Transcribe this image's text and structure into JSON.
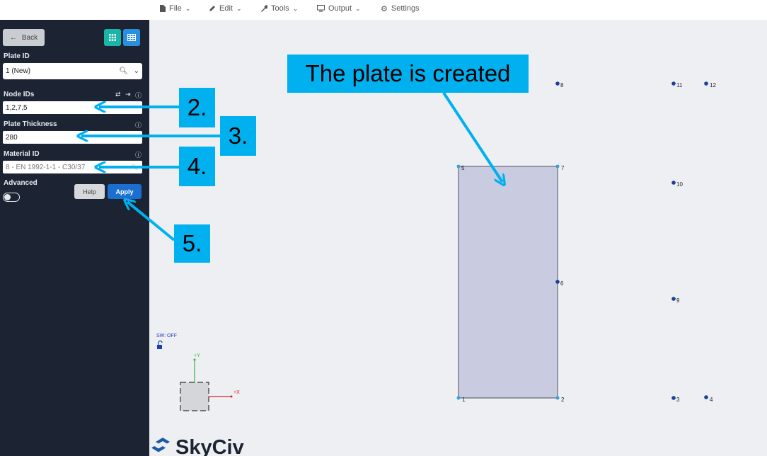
{
  "menu": {
    "file": "File",
    "edit": "Edit",
    "tools": "Tools",
    "output": "Output",
    "settings": "Settings"
  },
  "sidebar": {
    "back_label": "Back",
    "plate_id_label": "Plate ID",
    "plate_id_value": "1 (New)",
    "node_ids_label": "Node IDs",
    "node_ids_value": "1,2,7,5",
    "thickness_label": "Plate Thickness",
    "thickness_value": "280",
    "material_label": "Material ID",
    "material_value": "8 - EN 1992-1-1 - C30/37",
    "advanced_label": "Advanced",
    "help_label": "Help",
    "apply_label": "Apply"
  },
  "canvas": {
    "sw_status": "SW: OFF",
    "axis_y": "+Y",
    "axis_x": "+X",
    "nodes": [
      "1",
      "2",
      "3",
      "4",
      "5",
      "6",
      "7",
      "8",
      "9",
      "10",
      "11",
      "12"
    ],
    "logo_text": "SkyCiv"
  },
  "annotations": {
    "title": "The plate is created",
    "step2": "2.",
    "step3": "3.",
    "step4": "4.",
    "step5": "5."
  },
  "colors": {
    "sidebar_bg": "#1c2433",
    "canvas_bg": "#edeff2",
    "plate_fill": "#c9cbe0",
    "node_blue": "#1d3f9c",
    "node_cyan": "#3aa0d8",
    "callout": "#00b0ef",
    "apply_blue": "#1a6fd0",
    "view_teal": "#19b5a7",
    "view_blue": "#2b8fe0"
  }
}
